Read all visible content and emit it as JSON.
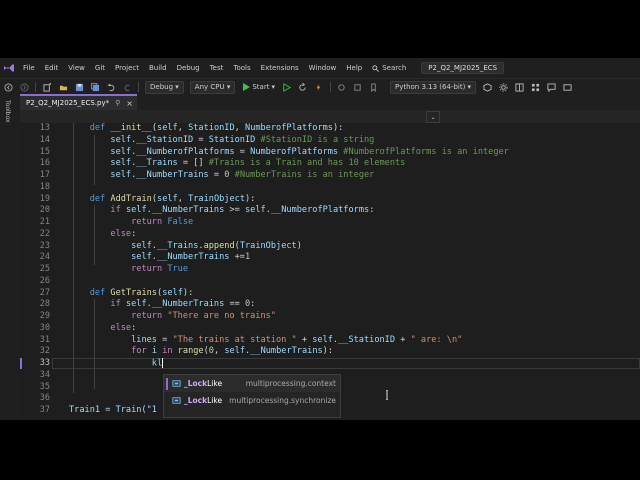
{
  "menubar": {
    "items": [
      "File",
      "Edit",
      "View",
      "Git",
      "Project",
      "Build",
      "Debug",
      "Test",
      "Tools",
      "Extensions",
      "Window",
      "Help"
    ],
    "search": "Search",
    "project_name": "P2_Q2_MJ2025_ECS"
  },
  "toolbar": {
    "config": "Debug",
    "platform": "Any CPU",
    "start": "Start",
    "env": "Python 3.13 (64-bit)"
  },
  "left_tool": {
    "label": "Toolbox"
  },
  "tab": {
    "label": "P2_Q2_MJ2025_ECS.py*"
  },
  "editor": {
    "line_numbers": [
      "13",
      "14",
      "15",
      "16",
      "17",
      "18",
      "19",
      "20",
      "21",
      "22",
      "23",
      "24",
      "25",
      "26",
      "27",
      "28",
      "29",
      "30",
      "31",
      "32",
      "33",
      "34",
      "35",
      "36",
      "37"
    ],
    "current_line": "33",
    "typed_text": "kl",
    "last_line_text": "Train1 = Train(\"1"
  },
  "autocomplete": {
    "items": [
      {
        "name_prefix": "_Lock",
        "name_rest": "Like",
        "module": "multiprocessing.context"
      },
      {
        "name_prefix": "_Lock",
        "name_rest": "Like",
        "module": "multiprocessing.synchronize"
      }
    ]
  }
}
